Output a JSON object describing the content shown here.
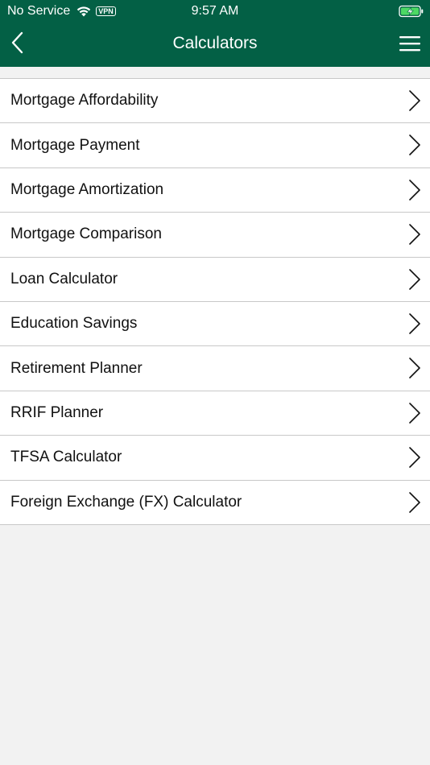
{
  "status_bar": {
    "carrier": "No Service",
    "vpn": "VPN",
    "time": "9:57 AM"
  },
  "nav": {
    "title": "Calculators",
    "back_icon": "chevron-left-icon",
    "menu_icon": "hamburger-menu-icon"
  },
  "colors": {
    "header_bg": "#036045",
    "page_bg": "#f2f2f2",
    "row_bg": "#ffffff",
    "divider": "#c8c8c8"
  },
  "calculators": [
    {
      "label": "Mortgage Affordability"
    },
    {
      "label": "Mortgage Payment"
    },
    {
      "label": "Mortgage Amortization"
    },
    {
      "label": "Mortgage Comparison"
    },
    {
      "label": "Loan Calculator"
    },
    {
      "label": "Education Savings"
    },
    {
      "label": "Retirement Planner"
    },
    {
      "label": "RRIF Planner"
    },
    {
      "label": "TFSA Calculator"
    },
    {
      "label": "Foreign Exchange (FX) Calculator"
    }
  ]
}
